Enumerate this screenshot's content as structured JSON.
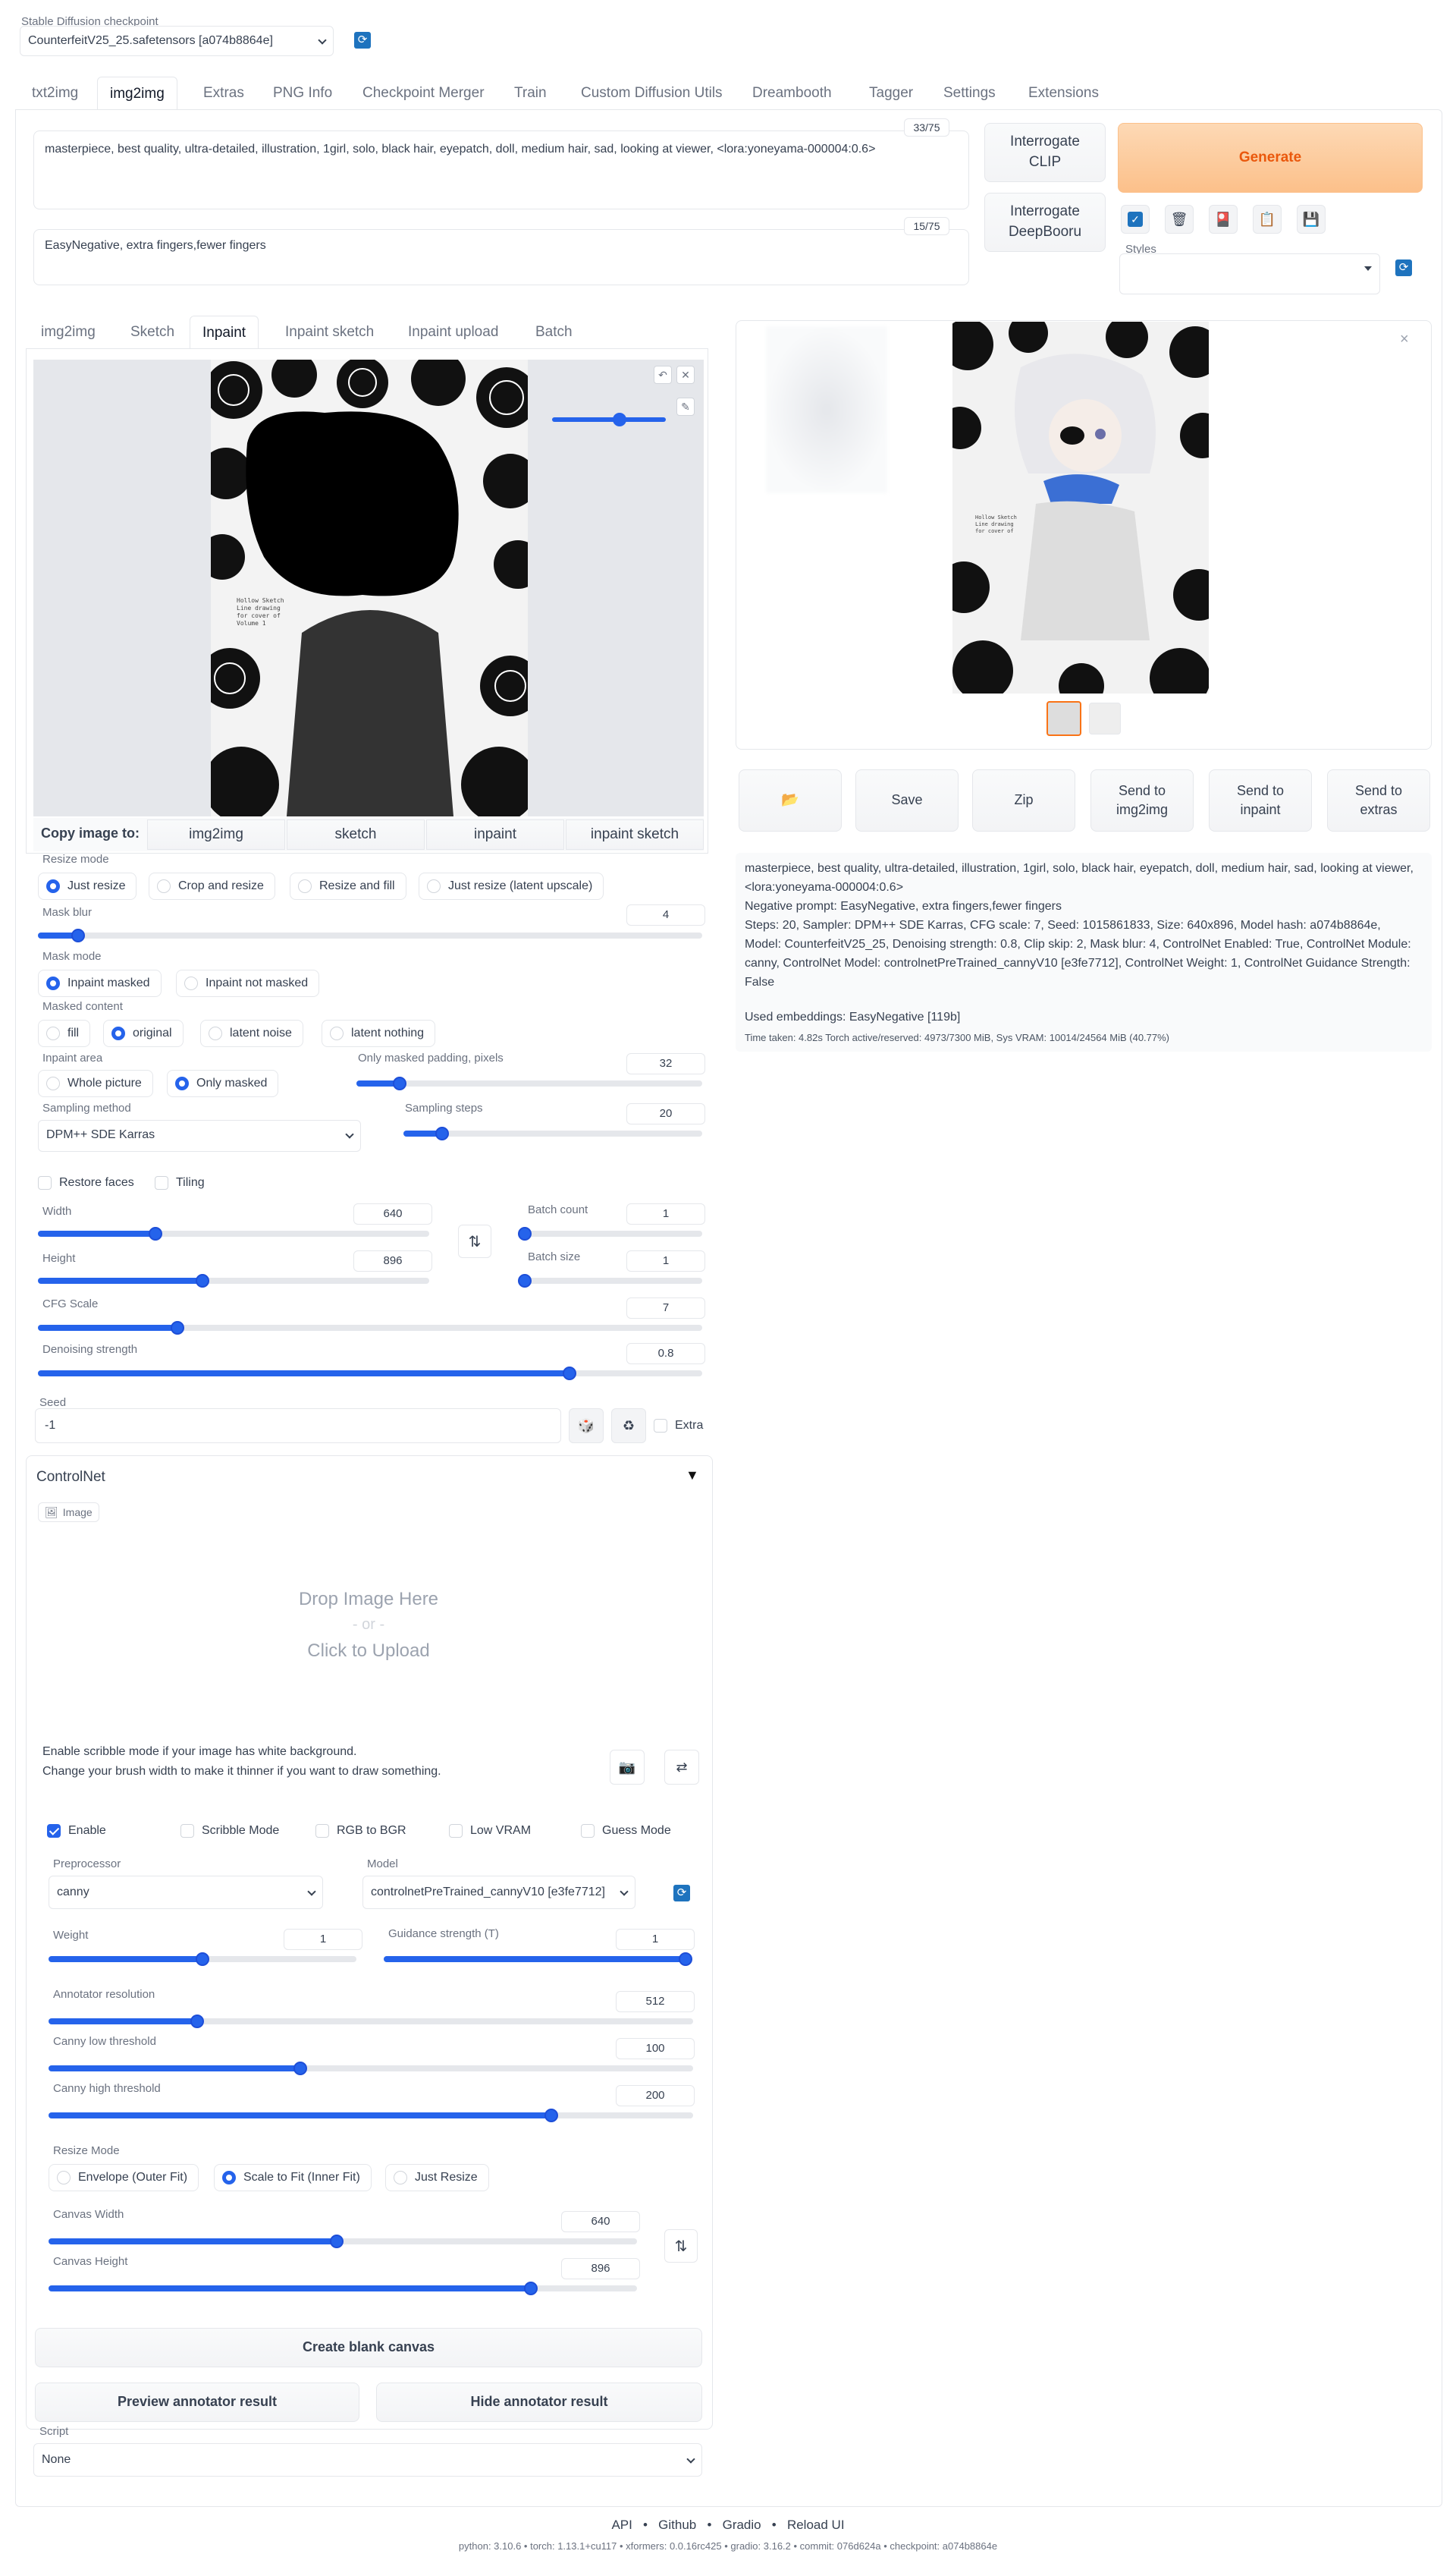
{
  "checkpoint": {
    "label": "Stable Diffusion checkpoint",
    "value": "CounterfeitV25_25.safetensors [a074b8864e]"
  },
  "tabs": [
    "txt2img",
    "img2img",
    "Extras",
    "PNG Info",
    "Checkpoint Merger",
    "Train",
    "Custom Diffusion Utils",
    "Dreambooth",
    "Tagger",
    "Settings",
    "Extensions"
  ],
  "prompt": {
    "text": "masterpiece, best quality, ultra-detailed, illustration, 1girl, solo, black hair, eyepatch, doll, medium hair, sad, looking at viewer,  <lora:yoneyama-000004:0.6>",
    "count": "33/75"
  },
  "negative": {
    "text": "EasyNegative, extra fingers,fewer fingers",
    "count": "15/75"
  },
  "buttons": {
    "interrogate_clip": "Interrogate\nCLIP",
    "interrogate_deepbooru": "Interrogate\nDeepBooru",
    "generate": "Generate",
    "styles_label": "Styles"
  },
  "subtabs": [
    "img2img",
    "Sketch",
    "Inpaint",
    "Inpaint sketch",
    "Inpaint upload",
    "Batch"
  ],
  "copy_to": {
    "label": "Copy image to:",
    "targets": [
      "img2img",
      "sketch",
      "inpaint",
      "inpaint sketch"
    ]
  },
  "resize_mode": {
    "label": "Resize mode",
    "options": [
      "Just resize",
      "Crop and resize",
      "Resize and fill",
      "Just resize (latent upscale)"
    ],
    "selected": 0
  },
  "mask_blur": {
    "label": "Mask blur",
    "value": "4",
    "fraction": 0.06
  },
  "mask_mode": {
    "label": "Mask mode",
    "options": [
      "Inpaint masked",
      "Inpaint not masked"
    ],
    "selected": 0
  },
  "masked_content": {
    "label": "Masked content",
    "options": [
      "fill",
      "original",
      "latent noise",
      "latent nothing"
    ],
    "selected": 1
  },
  "inpaint_area": {
    "label": "Inpaint area",
    "options": [
      "Whole picture",
      "Only masked"
    ],
    "selected": 1
  },
  "padding": {
    "label": "Only masked padding, pixels",
    "value": "32",
    "fraction": 0.125
  },
  "sampling_method": {
    "label": "Sampling method",
    "value": "DPM++ SDE Karras"
  },
  "sampling_steps": {
    "label": "Sampling steps",
    "value": "20",
    "fraction": 0.13
  },
  "restore_faces": "Restore faces",
  "tiling": "Tiling",
  "width": {
    "label": "Width",
    "value": "640",
    "fraction": 0.3
  },
  "height": {
    "label": "Height",
    "value": "896",
    "fraction": 0.42
  },
  "batch_count": {
    "label": "Batch count",
    "value": "1",
    "fraction": 0
  },
  "batch_size": {
    "label": "Batch size",
    "value": "1",
    "fraction": 0
  },
  "cfg": {
    "label": "CFG Scale",
    "value": "7",
    "fraction": 0.21
  },
  "denoising": {
    "label": "Denoising strength",
    "value": "0.8",
    "fraction": 0.8
  },
  "seed": {
    "label": "Seed",
    "value": "-1",
    "extra": "Extra"
  },
  "controlnet": {
    "title": "ControlNet",
    "image_label": "Image",
    "drop": "Drop Image Here",
    "or": "- or -",
    "click": "Click to Upload",
    "hint1": "Enable scribble mode if your image has white background.",
    "hint2": "Change your brush width to make it thinner if you want to draw something.",
    "checks": [
      {
        "label": "Enable",
        "on": true
      },
      {
        "label": "Scribble Mode",
        "on": false
      },
      {
        "label": "RGB to BGR",
        "on": false
      },
      {
        "label": "Low VRAM",
        "on": false
      },
      {
        "label": "Guess Mode",
        "on": false
      }
    ],
    "preprocessor": {
      "label": "Preprocessor",
      "value": "canny"
    },
    "model": {
      "label": "Model",
      "value": "controlnetPreTrained_cannyV10 [e3fe7712]"
    },
    "weight": {
      "label": "Weight",
      "value": "1",
      "fraction": 0.5
    },
    "guidance": {
      "label": "Guidance strength (T)",
      "value": "1",
      "fraction": 1
    },
    "annotator": {
      "label": "Annotator resolution",
      "value": "512",
      "fraction": 0.23
    },
    "low": {
      "label": "Canny low threshold",
      "value": "100",
      "fraction": 0.39
    },
    "high": {
      "label": "Canny high threshold",
      "value": "200",
      "fraction": 0.78
    },
    "resize_mode": {
      "label": "Resize Mode",
      "options": [
        "Envelope (Outer Fit)",
        "Scale to Fit (Inner Fit)",
        "Just Resize"
      ],
      "selected": 1
    },
    "canvas_width": {
      "label": "Canvas Width",
      "value": "640",
      "fraction": 0.49
    },
    "canvas_height": {
      "label": "Canvas Height",
      "value": "896",
      "fraction": 0.82
    },
    "create_canvas": "Create blank canvas",
    "preview": "Preview annotator result",
    "hide": "Hide annotator result"
  },
  "script": {
    "label": "Script",
    "value": "None"
  },
  "output_buttons": [
    "📂",
    "Save",
    "Zip",
    "Send to\nimg2img",
    "Send to\ninpaint",
    "Send to\nextras"
  ],
  "info": {
    "prompt": "masterpiece, best quality, ultra-detailed, illustration, 1girl, solo, black hair, eyepatch, doll, medium hair, sad, looking at viewer, <lora:yoneyama-000004:0.6>",
    "negative": "Negative prompt: EasyNegative, extra fingers,fewer fingers",
    "params": "Steps: 20, Sampler: DPM++ SDE Karras, CFG scale: 7, Seed: 1015861833, Size: 640x896, Model hash: a074b8864e, Model: CounterfeitV25_25, Denoising strength: 0.8, Clip skip: 2, Mask blur: 4, ControlNet Enabled: True, ControlNet Module: canny, ControlNet Model: controlnetPreTrained_cannyV10 [e3fe7712], ControlNet Weight: 1, ControlNet Guidance Strength: False",
    "embeddings": "Used embeddings: EasyNegative [119b]",
    "time": "Time taken: 4.82s  Torch active/reserved: 4973/7300 MiB, Sys VRAM: 10014/24564 MiB (40.77%)"
  },
  "footer": {
    "links": [
      "API",
      "Github",
      "Gradio",
      "Reload UI"
    ],
    "versions": "python: 3.10.6  •  torch: 1.13.1+cu117  •  xformers: 0.0.16rc425  •  gradio: 3.16.2  •  commit: 076d624a  •  checkpoint: a074b8864e"
  }
}
